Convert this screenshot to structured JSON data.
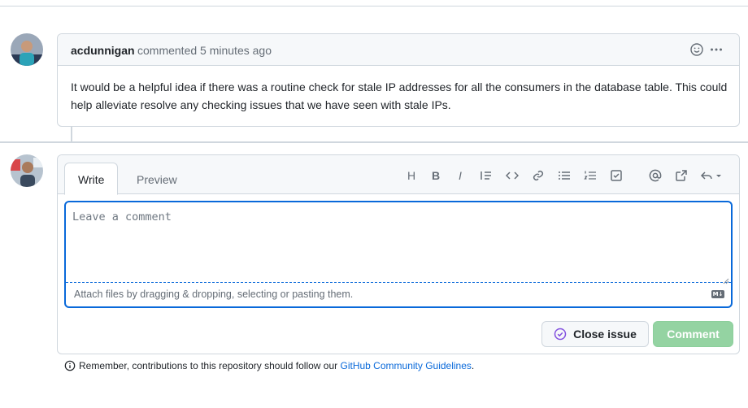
{
  "comment": {
    "author": "acdunnigan",
    "meta": "commented 5 minutes ago",
    "body": "It would be a helpful idea if there was a routine check for stale IP addresses for all the consumers in the database table. This could help alleviate resolve any checking issues that we have seen with stale IPs.",
    "actions": [
      "smiley-icon",
      "kebab-horizontal-icon"
    ]
  },
  "form": {
    "tabs": [
      "Write",
      "Preview"
    ],
    "active_tab": "Write",
    "toolbar": [
      "heading-icon",
      "bold-icon",
      "italic-icon",
      "quote-icon",
      "code-icon",
      "link-icon",
      "unordered-list-icon",
      "ordered-list-icon",
      "tasklist-icon",
      "mention-icon",
      "cross-reference-icon",
      "saved-replies-icon"
    ],
    "toolbar_glyphs": {
      "heading": "H",
      "bold": "B",
      "italic": "I"
    },
    "textarea": {
      "value": "",
      "placeholder": "Leave a comment"
    },
    "attach_text": "Attach files by dragging & dropping, selecting or pasting them.",
    "markdown_badge": "M↓",
    "close_issue_label": "Close issue",
    "comment_label": "Comment"
  },
  "guidelines": {
    "prefix": "Remember, contributions to this repository should follow our ",
    "link": "GitHub Community Guidelines",
    "suffix": "."
  },
  "colors": {
    "accent": "#0969da",
    "border": "#d0d7de",
    "header_bg": "#f6f8fa",
    "comment_button": "#94d3a2",
    "close_icon": "#8250df"
  }
}
